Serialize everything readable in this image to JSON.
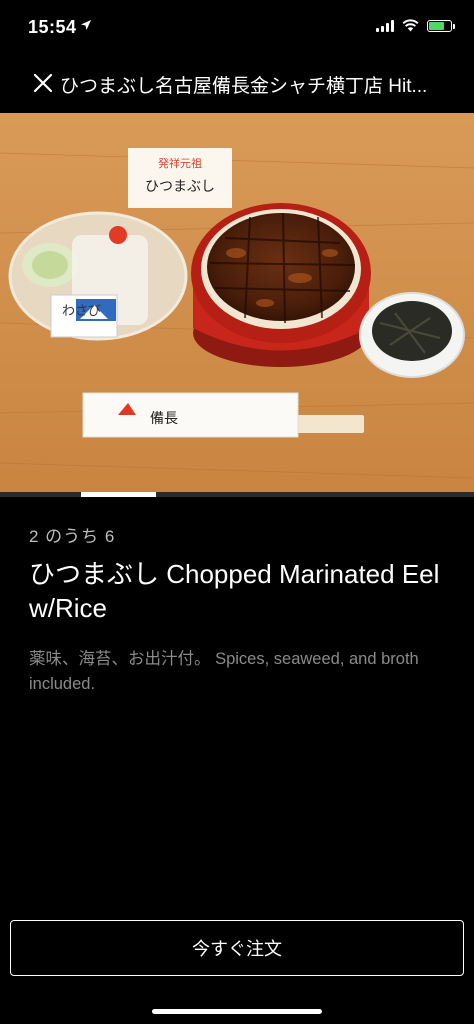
{
  "status_bar": {
    "time": "15:54",
    "icons": [
      "location-arrow-icon",
      "cellular-signal-icon",
      "wifi-icon",
      "battery-charging-icon"
    ],
    "battery_color": "#4cd964"
  },
  "header": {
    "title": "ひつまぶし名古屋備長金シャチ横丁店 Hit...",
    "close_icon": "close-icon"
  },
  "hero": {
    "image_text": {
      "sign_line1": "発祥元祖",
      "sign_line2": "ひつまぶし",
      "wasabi_label": "わさび",
      "chopsticks_brand": "備長"
    },
    "pager": {
      "current": 2,
      "total": 6
    }
  },
  "item": {
    "counter": "2 のうち 6",
    "title": "ひつまぶし Chopped Marinated Eel w/Rice",
    "description": "薬味、海苔、お出汁付。 Spices, seaweed, and broth included."
  },
  "order_button": {
    "label": "今すぐ注文"
  }
}
